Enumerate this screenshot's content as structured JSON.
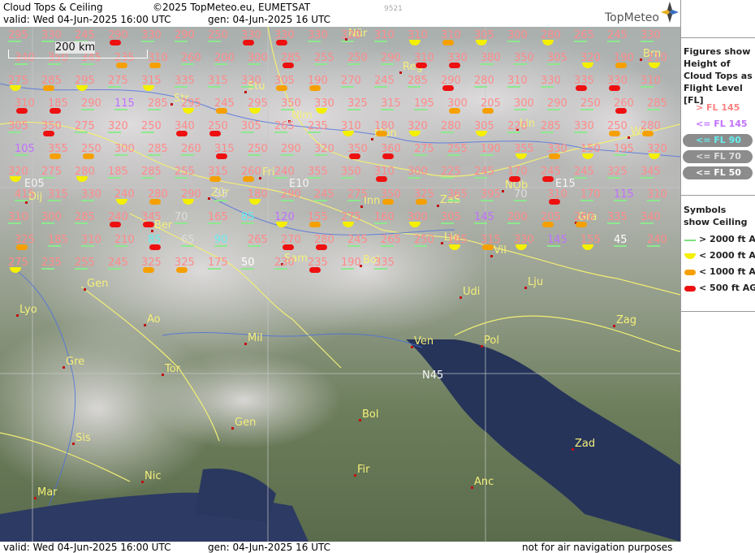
{
  "header": {
    "title": "Cloud Tops & Ceiling",
    "copyright": "©2025 TopMeteo.eu, EUMETSAT",
    "valid": "valid:  Wed  04-Jun-2025  16:00 UTC",
    "gen": "gen: 04-Jun-2025 16 UTC",
    "code": "9521",
    "logo": "TopMeteo"
  },
  "footer": {
    "valid": "valid:  Wed  04-Jun-2025  16:00 UTC",
    "gen": "gen: 04-Jun-2025 16 UTC",
    "note": "not for air navigation purposes"
  },
  "scale_bar": "200 km",
  "legend": {
    "figures_title": "Figures show Height of Cloud Tops as Flight Level  [FL]",
    "figure_items": [
      {
        "label": "> FL 145",
        "color": "#ff8080"
      },
      {
        "label": "<= FL 145",
        "color": "#c070ff"
      },
      {
        "label": "<= FL 90",
        "color": "#66eeee"
      },
      {
        "label": "<= FL 70",
        "color": "#dddddd"
      },
      {
        "label": "<= FL 50",
        "color": "#ffffff"
      }
    ],
    "symbols_title": "Symbols show Ceiling",
    "symbol_items": [
      {
        "label": "> 2000 ft AGL",
        "symbol": "green-dash"
      },
      {
        "label": "< 2000 ft AGL",
        "symbol": "yellow-semicircle"
      },
      {
        "label": "< 1000 ft AGL",
        "symbol": "orange-pill"
      },
      {
        "label": "< 500 ft AGL",
        "symbol": "red-pill"
      }
    ]
  },
  "grid_labels": [
    "E05",
    "E10",
    "E15",
    "N45"
  ],
  "cities": [
    "Nür",
    "Reg",
    "Brn",
    "Stu",
    "Str",
    "Ulm",
    "Mün",
    "Lin",
    "Wie",
    "Fri",
    "Zür",
    "Inn",
    "ZaS",
    "NÖb",
    "Dij",
    "Ber",
    "Gra",
    "Lie",
    "Vil",
    "Sam",
    "Bol",
    "Lju",
    "Gen",
    "Udi",
    "Lyo",
    "Ao",
    "Zag",
    "Mil",
    "Ven",
    "Pol",
    "Gre",
    "Tor",
    "Gen",
    "Bol",
    "Zad",
    "Sis",
    "Nic",
    "Fir",
    "Mar",
    "Anc"
  ],
  "tops": [
    "295",
    "330",
    "245",
    "290",
    "330",
    "290",
    "250",
    "330",
    "330",
    "330",
    "320",
    "310",
    "310",
    "310",
    "305",
    "300",
    "280",
    "265",
    "245",
    "330",
    "340",
    "350",
    "345",
    "235",
    "310",
    "260",
    "200",
    "300",
    "285",
    "255",
    "250",
    "290",
    "310",
    "330",
    "380",
    "350",
    "305",
    "320",
    "190",
    "210",
    "275",
    "285",
    "295",
    "275",
    "315",
    "335",
    "315",
    "330",
    "305",
    "190",
    "270",
    "245",
    "285",
    "290",
    "280",
    "310",
    "330",
    "335",
    "330",
    "310",
    "310",
    "185",
    "290",
    "115",
    "285",
    "295",
    "245",
    "295",
    "350",
    "330",
    "325",
    "315",
    "195",
    "300",
    "205",
    "300",
    "290",
    "250",
    "260",
    "285",
    "305",
    "350",
    "275",
    "320",
    "250",
    "340",
    "250",
    "305",
    "265",
    "235",
    "310",
    "180",
    "320",
    "280",
    "305",
    "220",
    "285",
    "330",
    "250",
    "280",
    "105",
    "355",
    "250",
    "300",
    "285",
    "260",
    "315",
    "250",
    "290",
    "320",
    "350",
    "360",
    "275",
    "255",
    "190",
    "355",
    "330",
    "150",
    "195",
    "320",
    "320",
    "275",
    "280",
    "185",
    "285",
    "255",
    "315",
    "260",
    "240",
    "355",
    "350",
    "310",
    "300",
    "225",
    "245",
    "170",
    "245",
    "245",
    "325",
    "345",
    "415",
    "315",
    "330",
    "240",
    "280",
    "290",
    "55",
    "180",
    "290",
    "245",
    "275",
    "350",
    "325",
    "365",
    "395",
    "70",
    "310",
    "170",
    "115",
    "310",
    "310",
    "300",
    "285",
    "240",
    "345",
    "70",
    "165",
    "85",
    "120",
    "155",
    "275",
    "160",
    "300",
    "305",
    "145",
    "200",
    "205",
    "260",
    "335",
    "340",
    "325",
    "185",
    "310",
    "210",
    "85",
    "65",
    "90",
    "265",
    "270",
    "280",
    "245",
    "265",
    "250",
    "165",
    "315",
    "330",
    "145",
    "155",
    "45",
    "240",
    "275",
    "235",
    "255",
    "245",
    "325",
    "325",
    "175",
    "50",
    "230",
    "235",
    "190",
    "335"
  ]
}
